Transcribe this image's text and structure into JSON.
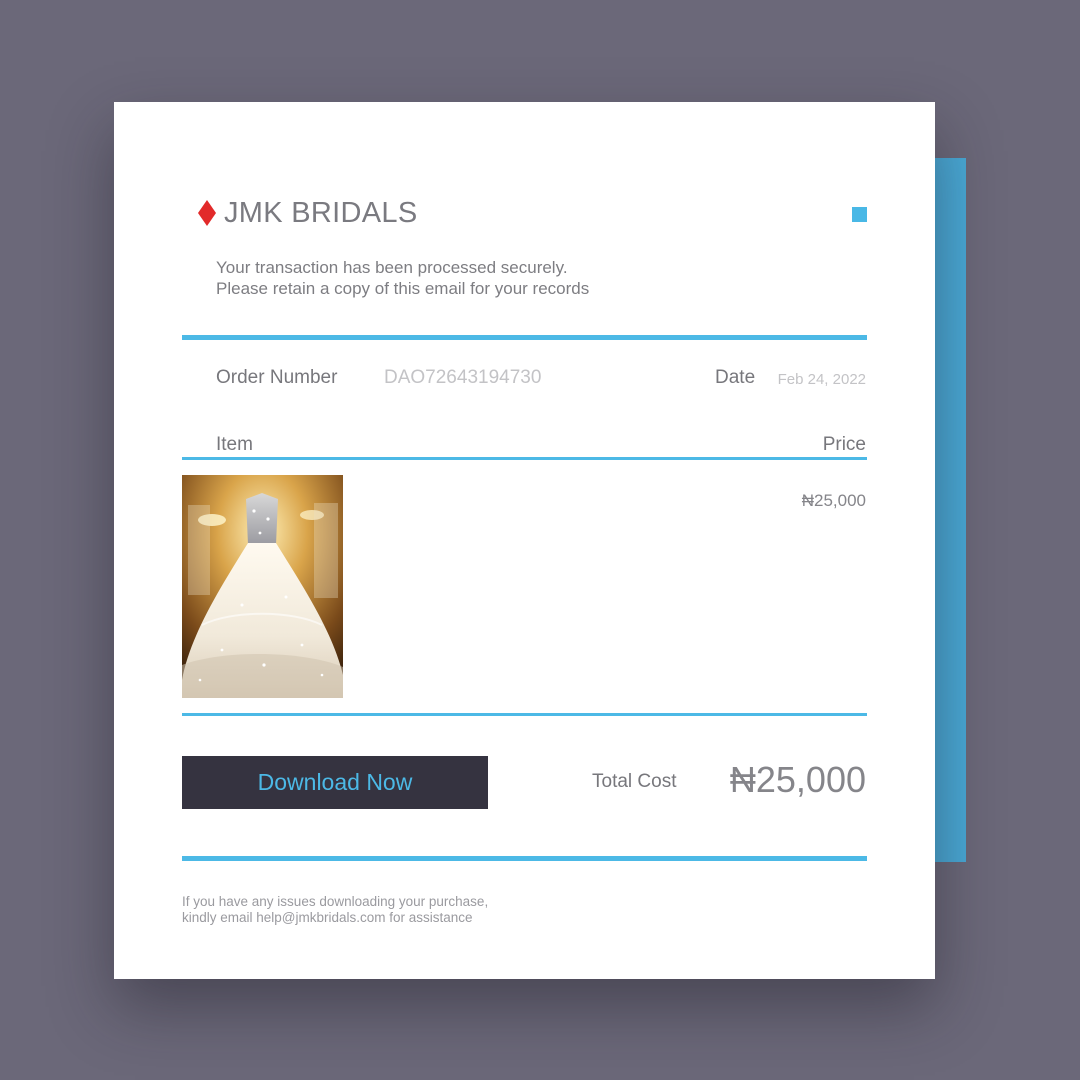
{
  "brand": {
    "name": "JMK BRIDALS",
    "icon": "diamond-icon",
    "icon_color": "#e22a2a"
  },
  "message": {
    "line1": "Your transaction has been processed securely.",
    "line2": "Please retain a copy of this email for your records"
  },
  "order": {
    "number_label": "Order Number",
    "number_value": "DAO72643194730",
    "date_label": "Date",
    "date_value": "Feb 24, 2022"
  },
  "table": {
    "item_header": "Item",
    "price_header": "Price",
    "rows": [
      {
        "image": "wedding-dress-photo",
        "price": "₦25,000"
      }
    ]
  },
  "actions": {
    "download_label": "Download Now"
  },
  "summary": {
    "total_label": "Total Cost",
    "total_value": "₦25,000"
  },
  "footer": {
    "line1": "If you have any issues downloading your purchase,",
    "line2": "kindly email help@jmkbridals.com for assistance"
  },
  "colors": {
    "accent": "#4cb9e6",
    "background": "#6b6879",
    "button_bg": "#353340",
    "card_bg": "#ffffff"
  }
}
